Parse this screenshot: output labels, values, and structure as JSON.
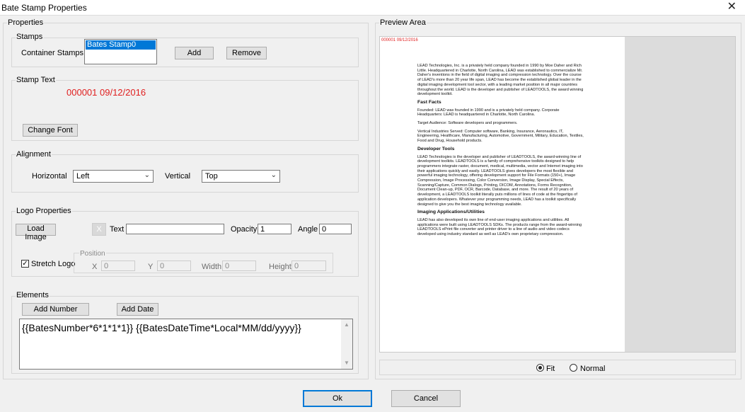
{
  "window": {
    "title": "Bate Stamp Properties",
    "close_glyph": "✕"
  },
  "properties": {
    "label": "Properties",
    "stamps": {
      "label": "Stamps",
      "container_label": "Container Stamps :",
      "items": [
        "Bates Stamp0"
      ],
      "add_label": "Add",
      "remove_label": "Remove"
    },
    "stamp_text": {
      "label": "Stamp Text",
      "text": "000001 09/12/2016",
      "color": "#e02020",
      "change_font_label": "Change Font"
    },
    "alignment": {
      "label": "Alignment",
      "horizontal_label": "Horizontal",
      "horizontal_value": "Left",
      "vertical_label": "Vertical",
      "vertical_value": "Top"
    },
    "logo": {
      "label": "Logo Properties",
      "load_image_label": "Load Image",
      "clear_glyph": "X",
      "text_label": "Text",
      "text_value": "",
      "opacity_label": "Opacity",
      "opacity_value": "1",
      "angle_label": "Angle",
      "angle_value": "0",
      "stretch_label": "Stretch Logo",
      "stretch_checked": "☑",
      "position_label": "Position",
      "x_label": "X",
      "x_value": "0",
      "y_label": "Y",
      "y_value": "0",
      "width_label": "Width",
      "width_value": "0",
      "height_label": "Height",
      "height_value": "0"
    },
    "elements": {
      "label": "Elements",
      "add_number_label": "Add Number",
      "add_date_label": "Add Date",
      "template": "{{BatesNumber*6*1*1*1}} {{BatesDateTime*Local*MM/dd/yyyy}}"
    }
  },
  "preview": {
    "label": "Preview Area",
    "stamp": "000001 09/12/2016",
    "paragraphs": [
      {
        "type": "p",
        "text": "LEAD Technologies, Inc. is a privately held company founded in 1990 by Moe Daher and Rich Little. Headquartered in Charlotte, North Carolina, LEAD was established to commercialize Mr. Daher's inventions in the field of digital imaging and compression technology. Over the course of LEAD's more than 20 year life span, LEAD has become the established global leader in the digital imaging development tool sector, with a leading market position in all major countries throughout the world. LEAD is the developer and publisher of LEADTOOLS, the award winning development toolkit."
      },
      {
        "type": "h",
        "text": "Fast Facts"
      },
      {
        "type": "p",
        "text": "Founded: LEAD was founded in 1990 and is a privately held company. Corporate Headquarters: LEAD is headquartered in Charlotte, North Carolina."
      },
      {
        "type": "p",
        "text": "Target Audience: Software developers and programmers."
      },
      {
        "type": "p",
        "text": "Vertical Industries Served: Computer software, Banking, Insurance, Aeronautics, IT, Engineering, Healthcare, Manufacturing, Automotive, Government, Military, Education, Textiles, Food and Drug, Household products."
      },
      {
        "type": "h",
        "text": "Developer Tools"
      },
      {
        "type": "p",
        "text": "LEAD Technologies is the developer and publisher of LEADTOOLS, the award-winning line of development toolkits. LEADTOOLS is a family of comprehensive toolkits designed to help programmers integrate raster, document, medical, multimedia, vector and Internet imaging into their applications quickly and easily. LEADTOOLS gives developers the most flexible and powerful imaging technology, offering development support for File Formats (150+), Image Compression, Image Processing, Color Conversion, Image Display, Special Effects, Scanning/Capture, Common Dialogs, Printing, DICOM, Annotations, Forms Recognition, Document Clean-up, PDF, OCR, Barcode, Database, and more. The result of 20 years of development, a LEADTOOLS toolkit literally puts millions of lines of code at the fingertips of application developers. Whatever your programming needs, LEAD has a toolkit specifically designed to give you the best imaging technology available."
      },
      {
        "type": "h",
        "text": "Imaging Applications/Utilities"
      },
      {
        "type": "p",
        "text": "LEAD has also developed its own line of end-user imaging applications and utilities. All applications were built using LEADTOOLS SDKs. The products range from the award-winning LEADTOOLS ePrint file converter and printer driver to a line of audio and video codecs developed using industry standard as well as LEAD's own proprietary compression."
      }
    ],
    "fit_label": "Fit",
    "normal_label": "Normal",
    "selected": "Fit"
  },
  "footer": {
    "ok_label": "Ok",
    "cancel_label": "Cancel"
  }
}
